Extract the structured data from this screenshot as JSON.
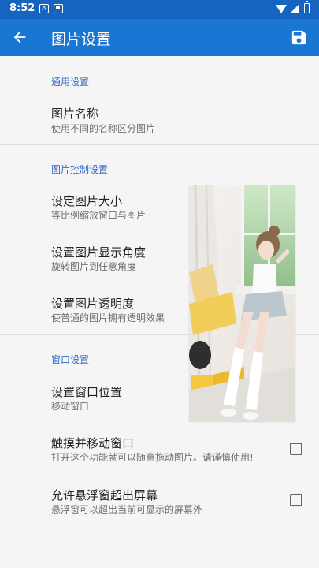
{
  "status_bar": {
    "time": "8:52",
    "notification_icons": [
      "a-icon",
      "image-icon"
    ],
    "system_icons": [
      "wifi-icon",
      "signal-icon",
      "battery-icon"
    ]
  },
  "toolbar": {
    "title": "图片设置",
    "back_icon": "arrow-back-icon",
    "save_icon": "save-icon"
  },
  "sections": {
    "general": {
      "header": "通用设置",
      "image_name": {
        "title": "图片名称",
        "subtitle": "使用不同的名称区分图片"
      }
    },
    "image_control": {
      "header": "图片控制设置",
      "image_size": {
        "title": "设定图片大小",
        "subtitle": "等比例缩放窗口与图片"
      },
      "image_angle": {
        "title": "设置图片显示角度",
        "subtitle": "旋转图片到任意角度"
      },
      "image_opacity": {
        "title": "设置图片透明度",
        "subtitle": "使普通的图片拥有透明效果"
      }
    },
    "window": {
      "header": "窗口设置",
      "window_position": {
        "title": "设置窗口位置",
        "subtitle": "移动窗口"
      },
      "touch_move": {
        "title": "触摸并移动窗口",
        "subtitle": "打开这个功能就可以随意拖动图片。请谨慎使用!",
        "checked": false
      },
      "allow_overflow": {
        "title": "允许悬浮窗超出屏幕",
        "subtitle": "悬浮窗可以超出当前可显示的屏幕外",
        "checked": false
      }
    }
  },
  "floating_image": {
    "description": "photo-overlay"
  },
  "colors": {
    "status_bar": "#1565c0",
    "toolbar": "#1976d2",
    "section_header": "#3568c4",
    "background": "#f5f5f5"
  }
}
